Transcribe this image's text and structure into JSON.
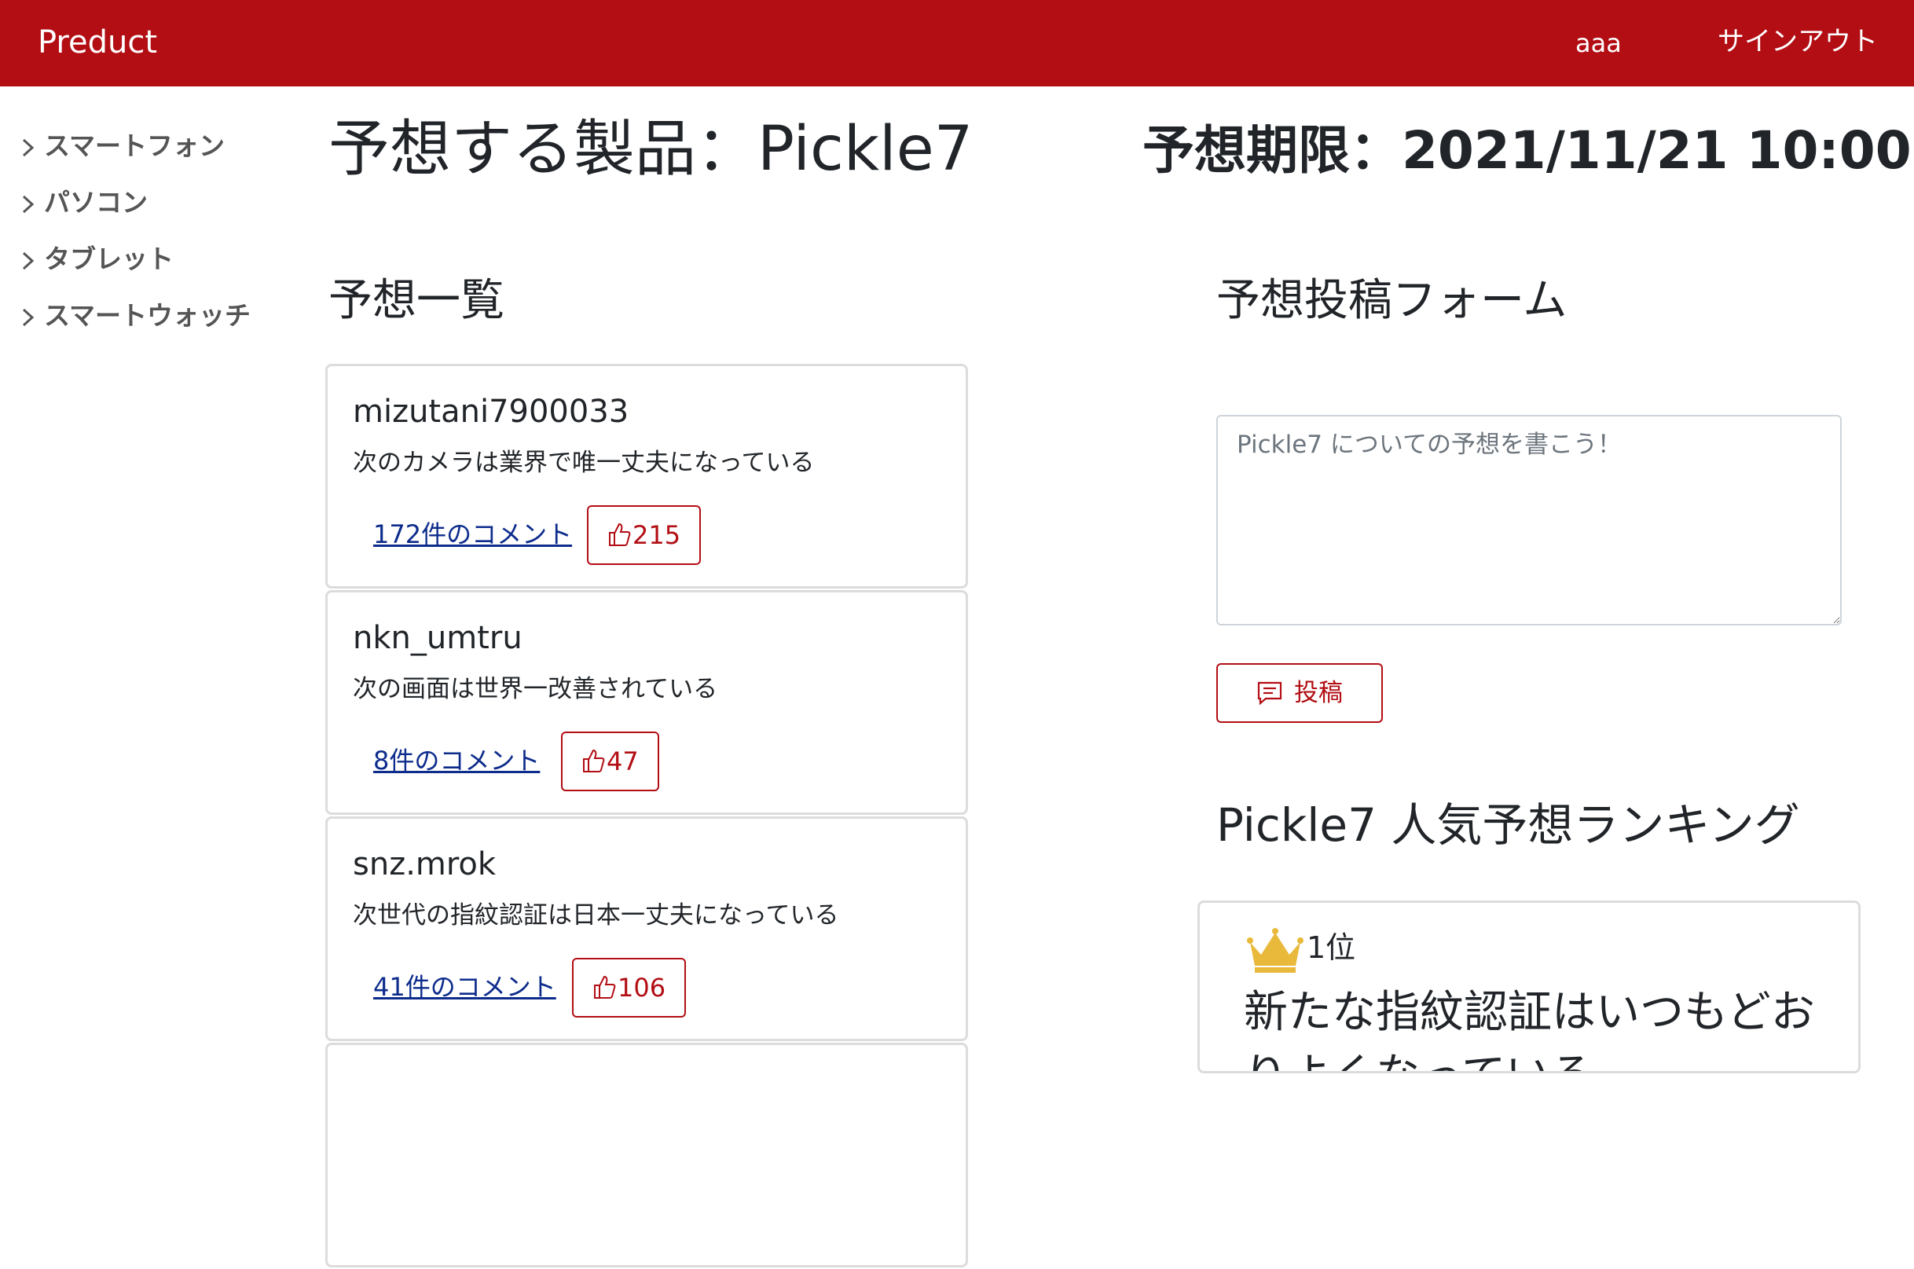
{
  "navbar": {
    "brand": "Preduct",
    "user": "aaa",
    "signout": "サインアウト",
    "color": "#b20e14"
  },
  "sidebar": {
    "items": [
      {
        "label": "スマートフォン"
      },
      {
        "label": "パソコン"
      },
      {
        "label": "タブレット"
      },
      {
        "label": "スマートウォッチ"
      }
    ]
  },
  "header": {
    "product_title": "予想する製品：Pickle7",
    "deadline": "予想期限：2021/11/21 10:00"
  },
  "predictions": {
    "heading": "予想一覧",
    "items": [
      {
        "user": "mizutani7900033",
        "text": "次のカメラは業界で唯一丈夫になっている",
        "comments": "172件のコメント",
        "likes": "215"
      },
      {
        "user": "nkn_umtru",
        "text": "次の画面は世界一改善されている",
        "comments": "8件のコメント",
        "likes": "47"
      },
      {
        "user": "snz.mrok",
        "text": "次世代の指紋認証は日本一丈夫になっている",
        "comments": "41件のコメント",
        "likes": "106"
      }
    ]
  },
  "form": {
    "heading": "予想投稿フォーム",
    "placeholder": "Pickle7 についての予想を書こう！",
    "submit_label": "投稿"
  },
  "ranking": {
    "heading": "Pickle7 人気予想ランキング",
    "first": {
      "position": "1位",
      "text": "新たな指紋認証はいつもどおりよくなっている"
    }
  }
}
